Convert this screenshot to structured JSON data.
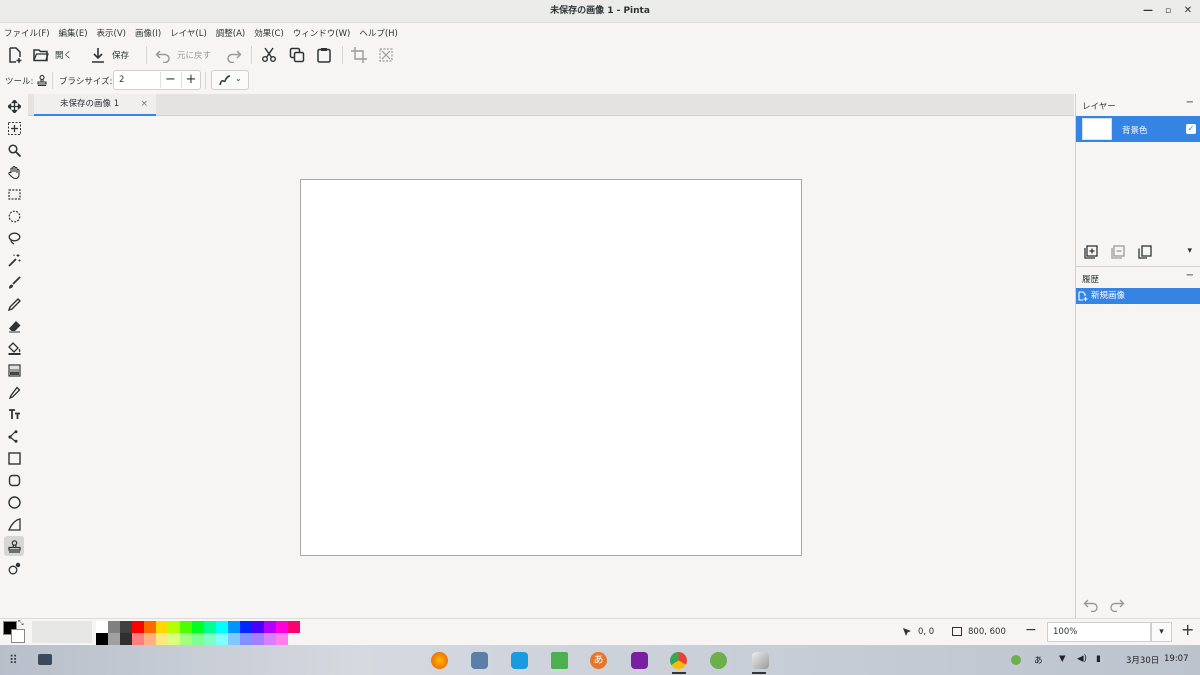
{
  "window": {
    "title": "未保存の画像 1 - Pinta",
    "min": "—",
    "max": "▫",
    "close": "✕"
  },
  "menu": [
    "ファイル(F)",
    "編集(E)",
    "表示(V)",
    "画像(I)",
    "レイヤ(L)",
    "調整(A)",
    "効果(C)",
    "ウィンドウ(W)",
    "ヘルプ(H)"
  ],
  "toolbar": {
    "open_label": "開く",
    "save_label": "保存",
    "undo_label": "元に戻す"
  },
  "tool_options": {
    "tool_label": "ツール:",
    "brush_size_label": "ブラシサイズ:",
    "brush_size_value": "2"
  },
  "tabs": [
    {
      "label": "未保存の画像 1",
      "close": "×"
    }
  ],
  "layers_panel": {
    "title": "レイヤー",
    "layers": [
      {
        "name": "背景色",
        "visible": true
      }
    ]
  },
  "history_panel": {
    "title": "履歴",
    "items": [
      {
        "label": "新規画像"
      }
    ]
  },
  "status": {
    "cursor_position": "0, 0",
    "selection_size": "800, 600",
    "zoom": "100%"
  },
  "colors": {
    "accent": "#3584e4",
    "primary": "#000000",
    "secondary": "#ffffff"
  },
  "palette": [
    "#ffffff",
    "#808080",
    "#404040",
    "#ff0000",
    "#ff6a00",
    "#ffd800",
    "#b6ff00",
    "#4cff00",
    "#00ff21",
    "#00ff90",
    "#00ffff",
    "#0094ff",
    "#0026ff",
    "#4800ff",
    "#b200ff",
    "#ff00dc",
    "#ff006e",
    "#000000",
    "#a0a0a0",
    "#303030",
    "#ff7f7f",
    "#ffb27f",
    "#ffe97f",
    "#daff7f",
    "#a5ff7f",
    "#7fff8e",
    "#7fffc5",
    "#7fffff",
    "#7fc9ff",
    "#7f92ff",
    "#a17fff",
    "#d67fff",
    "#ff7fed"
  ],
  "taskbar": {
    "ime": "あ",
    "date": "3月30日",
    "time": "19:07"
  }
}
